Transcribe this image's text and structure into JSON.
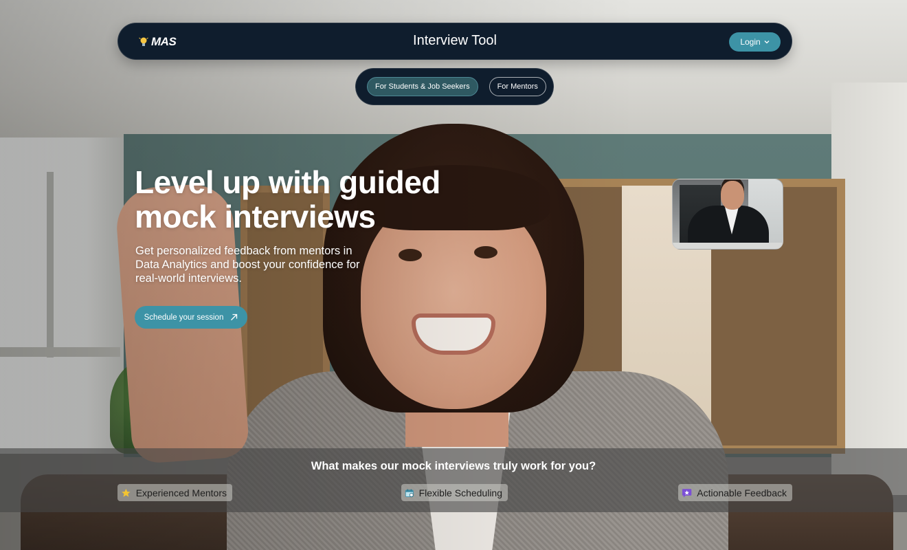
{
  "nav": {
    "logo_text": "MAS",
    "title": "Interview Tool",
    "login_label": "Login"
  },
  "audience_tabs": [
    {
      "label": "For Students & Job Seekers",
      "active": true
    },
    {
      "label": "For Mentors",
      "active": false
    }
  ],
  "hero": {
    "title": "Level up with guided mock interviews",
    "subtitle": "Get personalized feedback from mentors in Data Analytics and boost your confidence for real-world interviews.",
    "cta_label": "Schedule your session"
  },
  "features": {
    "heading": "What makes our mock interviews truly work for you?",
    "items": [
      {
        "label": "Experienced Mentors",
        "icon": "star-icon"
      },
      {
        "label": "Flexible Scheduling",
        "icon": "calendar-icon"
      },
      {
        "label": "Actionable Feedback",
        "icon": "feedback-icon"
      }
    ]
  },
  "colors": {
    "nav_bg": "#0f1d2d",
    "accent": "#3d93a6",
    "active_tab": "#2f5962"
  }
}
